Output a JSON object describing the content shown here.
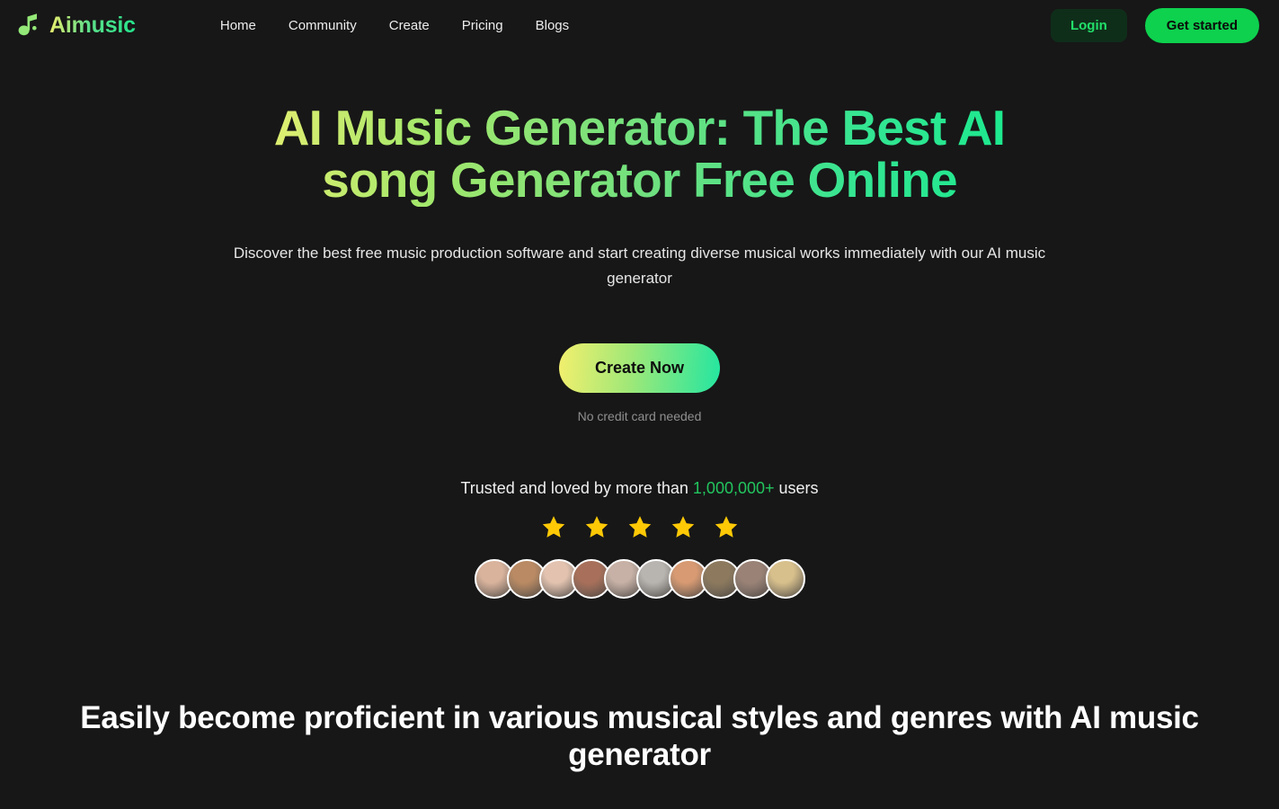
{
  "brand": {
    "name": "Aimusic",
    "icon": "music-note-icon"
  },
  "nav": {
    "items": [
      {
        "label": "Home"
      },
      {
        "label": "Community"
      },
      {
        "label": "Create"
      },
      {
        "label": "Pricing"
      },
      {
        "label": "Blogs"
      }
    ]
  },
  "header_actions": {
    "login_label": "Login",
    "get_started_label": "Get started"
  },
  "hero": {
    "title": "AI Music Generator: The Best AI song Generator Free Online",
    "subtitle": "Discover the best free music production software and start creating diverse musical works immediately with our AI music generator",
    "cta_label": "Create Now",
    "cta_note": "No credit card needed"
  },
  "social_proof": {
    "prefix": "Trusted and loved by more than ",
    "count": "1,000,000+",
    "suffix": " users",
    "star_count": 5,
    "star_icon": "star-icon",
    "avatar_count": 10,
    "avatars": [
      {
        "name": "user-avatar-1",
        "tone": "#d9b39c"
      },
      {
        "name": "user-avatar-2",
        "tone": "#b98a63"
      },
      {
        "name": "user-avatar-3",
        "tone": "#e3c3b0"
      },
      {
        "name": "user-avatar-4",
        "tone": "#a8705a"
      },
      {
        "name": "user-avatar-5",
        "tone": "#c7b1a6"
      },
      {
        "name": "user-avatar-6",
        "tone": "#b8b4b0"
      },
      {
        "name": "user-avatar-7",
        "tone": "#d79a72"
      },
      {
        "name": "user-avatar-8",
        "tone": "#8d7a5e"
      },
      {
        "name": "user-avatar-9",
        "tone": "#9a8276"
      },
      {
        "name": "user-avatar-10",
        "tone": "#d8c08c"
      }
    ]
  },
  "section_styles": {
    "heading": "Easily become proficient in various musical styles and genres with AI music generator"
  },
  "colors": {
    "background": "#171717",
    "accent_green": "#0ed14e",
    "accent_teal": "#18ea8d",
    "accent_yellow": "#e9ef72",
    "star_gold": "#FFC906",
    "login_bg": "#0f2e1a",
    "login_text": "#22e06a",
    "muted_text": "#8f8f8f"
  }
}
